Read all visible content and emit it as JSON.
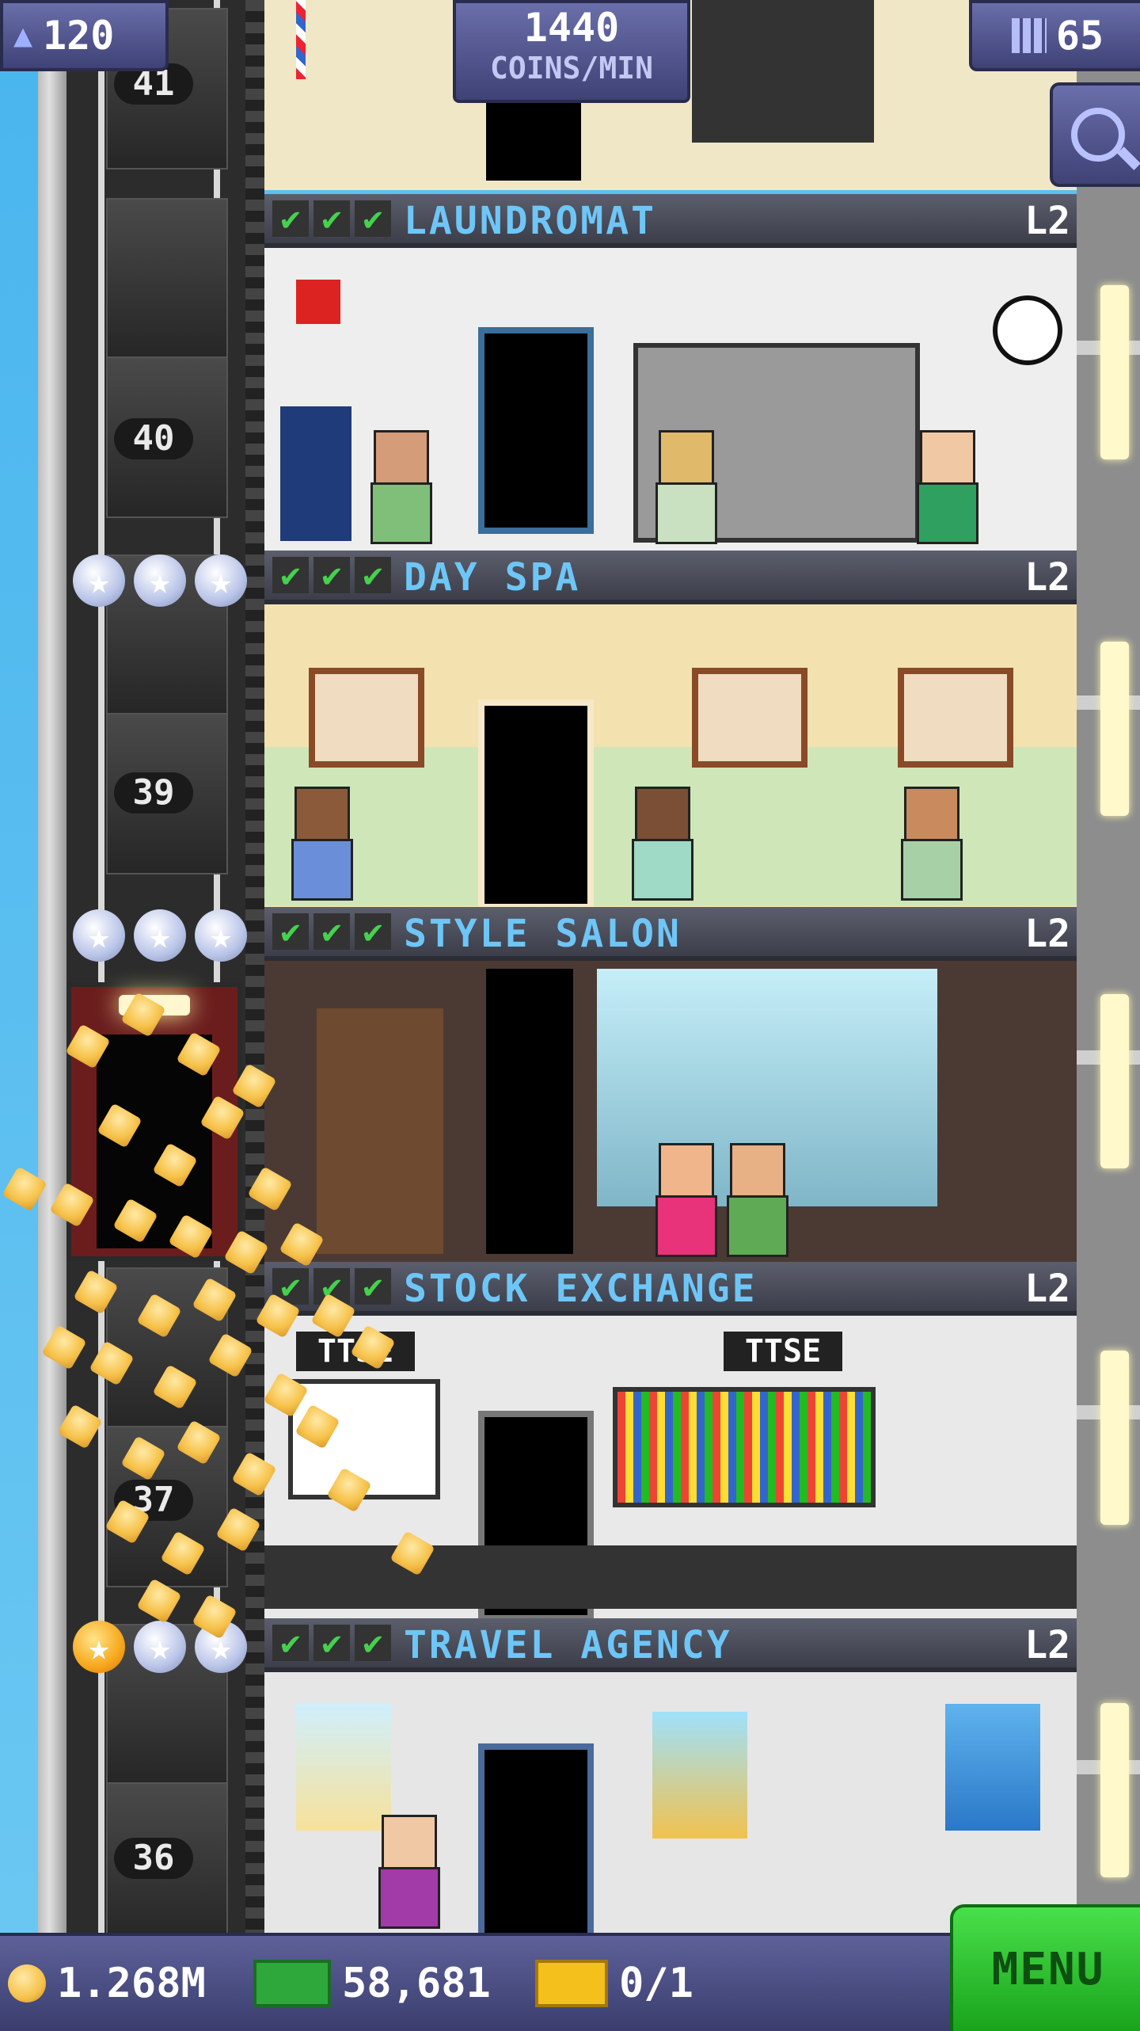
{
  "hud": {
    "population": "120",
    "coins_rate_value": "1440",
    "coins_rate_unit": "COINS/MIN",
    "floors_count": "65"
  },
  "shaft": {
    "floor_numbers": [
      "41",
      "40",
      "39",
      "37",
      "36"
    ]
  },
  "floors": [
    {
      "name": "LAUNDROMAT",
      "level": "L2",
      "checks": "✔"
    },
    {
      "name": "DAY SPA",
      "level": "L2",
      "checks": "✔"
    },
    {
      "name": "STYLE SALON",
      "level": "L2",
      "checks": "✔"
    },
    {
      "name": "STOCK EXCHANGE",
      "level": "L2",
      "checks": "✔",
      "signs": [
        "TTSE",
        "TTSE"
      ]
    },
    {
      "name": "TRAVEL AGENCY",
      "level": "L2",
      "checks": "✔"
    }
  ],
  "bottom": {
    "coins": "1.268M",
    "bux": "58,681",
    "tickets": "0/1",
    "menu_label": "MENU"
  },
  "icons": {
    "population": "person-icon",
    "floors": "building-icon",
    "search": "magnifier-icon",
    "coin": "coin-icon",
    "bux": "bux-icon",
    "ticket": "ticket-icon"
  },
  "colors": {
    "floor_name": "#6ec6f7",
    "check": "#45d14e",
    "hud": "#4f5388",
    "menu": "#2cc530"
  }
}
